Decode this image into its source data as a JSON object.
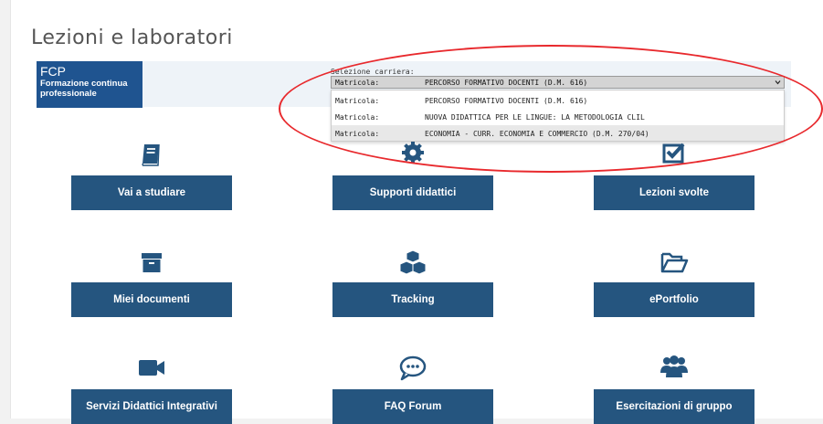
{
  "page": {
    "title": "Lezioni e laboratori"
  },
  "course": {
    "code": "FCP",
    "name_line1": "Formazione continua",
    "name_line2": "professionale"
  },
  "career": {
    "label": "Selezione carriera:",
    "selected": {
      "prefix": "Matricola:",
      "value": "PERCORSO FORMATIVO DOCENTI (D.M. 616)"
    },
    "options": [
      {
        "prefix": "Matricola:",
        "value": "PERCORSO FORMATIVO DOCENTI (D.M. 616)"
      },
      {
        "prefix": "Matricola:",
        "value": "NUOVA DIDATTICA PER LE LINGUE: LA METODOLOGIA CLIL"
      },
      {
        "prefix": "Matricola:",
        "value": "ECONOMIA - CURR. ECONOMIA E COMMERCIO (D.M. 270/04)"
      }
    ]
  },
  "tiles": {
    "studiare": {
      "label": "Vai a studiare",
      "icon": "book-icon"
    },
    "supporti": {
      "label": "Supporti didattici",
      "icon": "gear-icon"
    },
    "lezioni": {
      "label": "Lezioni svolte",
      "icon": "checkbox-icon"
    },
    "documenti": {
      "label": "Miei documenti",
      "icon": "archive-box-icon"
    },
    "tracking": {
      "label": "Tracking",
      "icon": "cubes-icon"
    },
    "portfolio": {
      "label": "ePortfolio",
      "icon": "folder-open-icon"
    },
    "servizi": {
      "label": "Servizi Didattici Integrativi",
      "icon": "video-camera-icon"
    },
    "faq": {
      "label": "FAQ Forum",
      "icon": "chat-bubble-icon"
    },
    "gruppo": {
      "label": "Esercitazioni di gruppo",
      "icon": "users-icon"
    }
  },
  "colors": {
    "tile_button": "#25557f",
    "badge": "#1f5490",
    "highlight_ellipse": "#e8292d",
    "icon": "#25557f"
  }
}
